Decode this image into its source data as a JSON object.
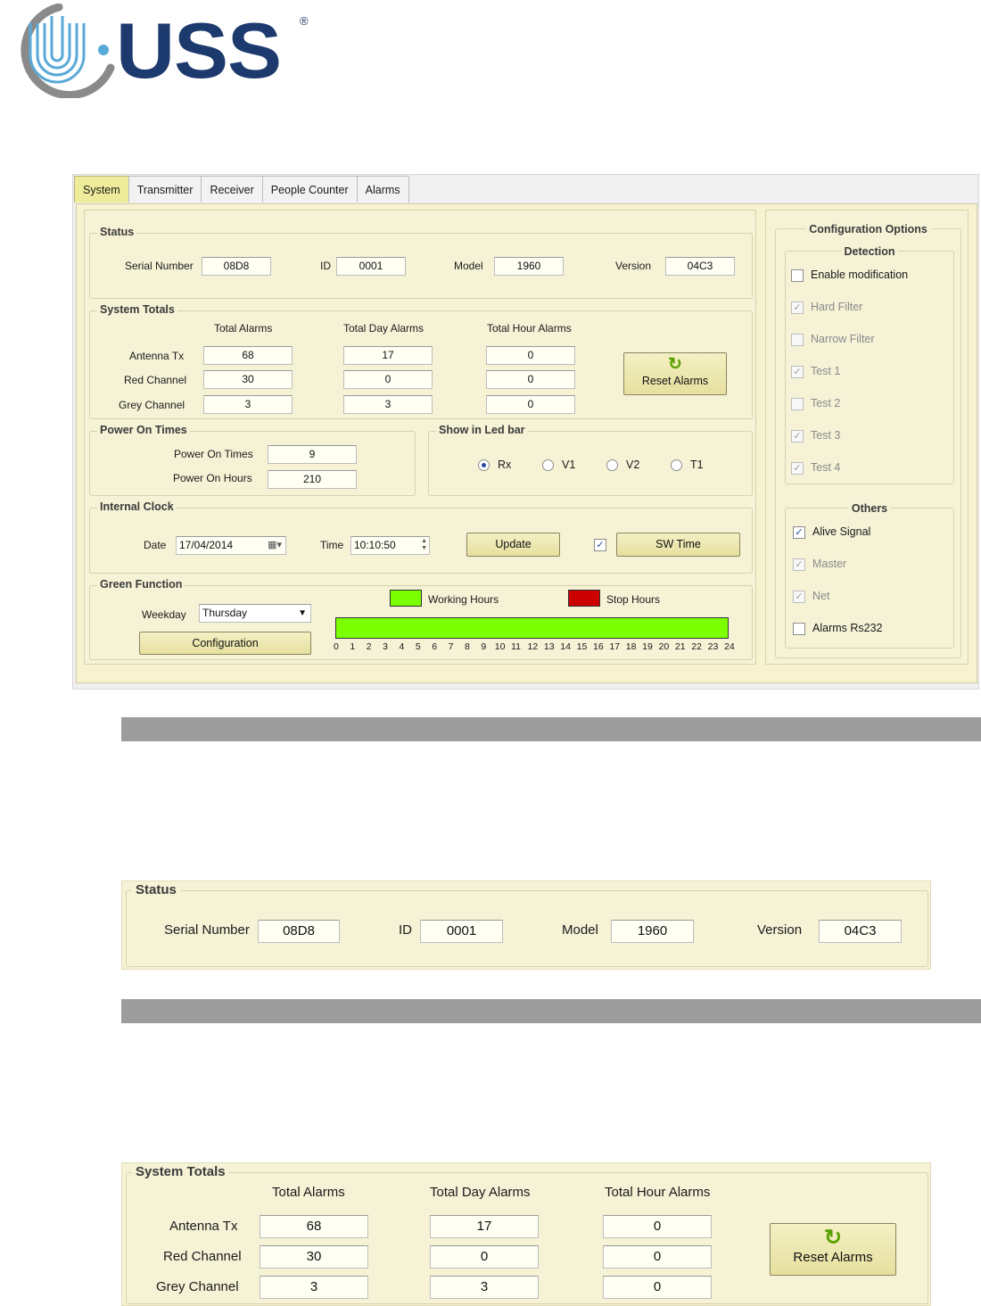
{
  "logo": {
    "text": "USS",
    "registered": "®"
  },
  "tabs": [
    "System",
    "Transmitter",
    "Receiver",
    "People Counter",
    "Alarms"
  ],
  "status": {
    "title": "Status",
    "serial_label": "Serial Number",
    "serial_value": "08D8",
    "id_label": "ID",
    "id_value": "0001",
    "model_label": "Model",
    "model_value": "1960",
    "version_label": "Version",
    "version_value": "04C3"
  },
  "totals": {
    "title": "System Totals",
    "headers": [
      "Total Alarms",
      "Total Day Alarms",
      "Total Hour Alarms"
    ],
    "rows": [
      {
        "label": "Antenna Tx",
        "values": [
          "68",
          "17",
          "0"
        ]
      },
      {
        "label": "Red Channel",
        "values": [
          "30",
          "0",
          "0"
        ]
      },
      {
        "label": "Grey Channel",
        "values": [
          "3",
          "3",
          "0"
        ]
      }
    ],
    "reset_label": "Reset Alarms"
  },
  "power": {
    "title": "Power On Times",
    "times_label": "Power On Times",
    "times_value": "9",
    "hours_label": "Power On Hours",
    "hours_value": "210"
  },
  "ledbar": {
    "title": "Show in Led bar",
    "options": [
      "Rx",
      "V1",
      "V2",
      "T1"
    ],
    "selected": "Rx"
  },
  "clock": {
    "title": "Internal Clock",
    "date_label": "Date",
    "date_value": "17/04/2014",
    "time_label": "Time",
    "time_value": "10:10:50",
    "update_label": "Update",
    "sw_time_checked": true,
    "sw_time_label": "SW Time"
  },
  "green": {
    "title": "Green Function",
    "weekday_label": "Weekday",
    "weekday_value": "Thursday",
    "config_label": "Configuration",
    "working_label": "Working Hours",
    "working_color": "#7cff00",
    "stop_label": "Stop Hours",
    "stop_color": "#cc0000",
    "hours": [
      "0",
      "1",
      "2",
      "3",
      "4",
      "5",
      "6",
      "7",
      "8",
      "9",
      "10",
      "11",
      "12",
      "13",
      "14",
      "15",
      "16",
      "17",
      "18",
      "19",
      "20",
      "21",
      "22",
      "23",
      "24"
    ]
  },
  "config": {
    "title": "Configuration Options",
    "detection_title": "Detection",
    "detection": [
      {
        "label": "Enable modification",
        "checked": false,
        "enabled": true
      },
      {
        "label": "Hard Filter",
        "checked": true,
        "enabled": false
      },
      {
        "label": "Narrow Filter",
        "checked": false,
        "enabled": false
      },
      {
        "label": "Test 1",
        "checked": true,
        "enabled": false
      },
      {
        "label": "Test 2",
        "checked": false,
        "enabled": false
      },
      {
        "label": "Test 3",
        "checked": true,
        "enabled": false
      },
      {
        "label": "Test 4",
        "checked": true,
        "enabled": false
      }
    ],
    "others_title": "Others",
    "others": [
      {
        "label": "Alive Signal",
        "checked": true,
        "enabled": true
      },
      {
        "label": "Master",
        "checked": true,
        "enabled": false
      },
      {
        "label": "Net",
        "checked": true,
        "enabled": false
      },
      {
        "label": "Alarms Rs232",
        "checked": false,
        "enabled": true
      }
    ]
  }
}
